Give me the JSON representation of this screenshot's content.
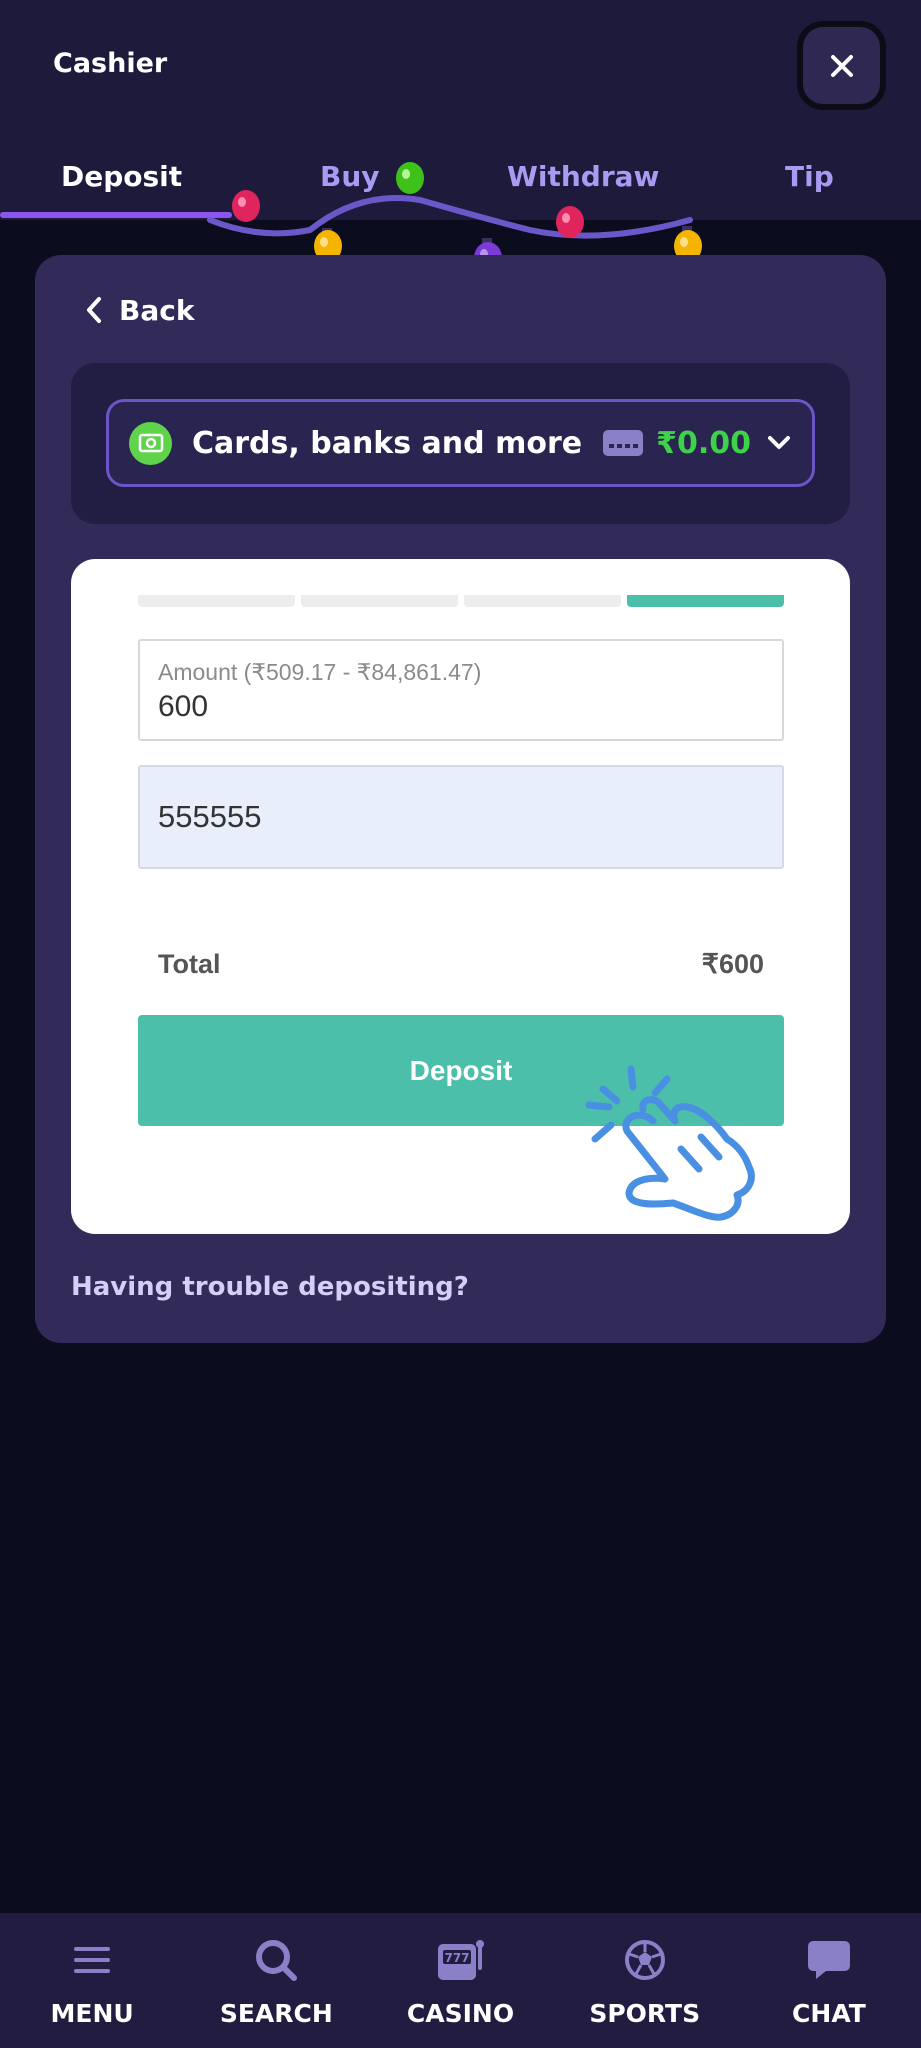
{
  "header": {
    "title": "Cashier",
    "close_icon": "close-icon"
  },
  "tabs": [
    {
      "label": "Deposit",
      "active": true
    },
    {
      "label": "Buy",
      "active": false
    },
    {
      "label": "Withdraw",
      "active": false
    },
    {
      "label": "Tip",
      "active": false
    }
  ],
  "panel": {
    "back_label": "Back",
    "method": {
      "label": "Cards, banks and more",
      "balance": "₹0.00",
      "balance_color": "#3ed14a"
    },
    "form": {
      "steps_completed": 4,
      "steps_total": 4,
      "amount_label": "Amount (₹509.17 - ₹84,861.47)",
      "amount_value": "600",
      "code_value": "555555",
      "total_label": "Total",
      "total_value": "₹600",
      "deposit_label": "Deposit",
      "accent_color": "#4cbfaa"
    },
    "trouble_link": "Having trouble depositing?"
  },
  "bottom_nav": [
    {
      "label": "MENU",
      "icon": "menu-icon"
    },
    {
      "label": "SEARCH",
      "icon": "search-icon"
    },
    {
      "label": "CASINO",
      "icon": "slot-machine-icon"
    },
    {
      "label": "SPORTS",
      "icon": "soccer-ball-icon"
    },
    {
      "label": "CHAT",
      "icon": "chat-bubble-icon"
    }
  ]
}
